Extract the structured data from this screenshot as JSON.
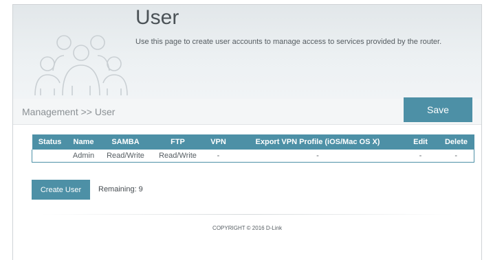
{
  "header": {
    "title": "User",
    "description": "Use this page to create user accounts to manage access to services provided by the router.",
    "icon": "user-group-icon"
  },
  "breadcrumb": "Management >> User",
  "toolbar": {
    "save_label": "Save"
  },
  "table": {
    "columns": [
      "Status",
      "Name",
      "SAMBA",
      "FTP",
      "VPN",
      "Export VPN Profile (iOS/Mac OS X)",
      "Edit",
      "Delete"
    ],
    "rows": [
      [
        "",
        "Admin",
        "Read/Write",
        "Read/Write",
        "-",
        "-",
        "-",
        "-"
      ]
    ]
  },
  "create_user": {
    "label": "Create User"
  },
  "remaining": {
    "label": "Remaining:",
    "value": "9"
  },
  "footer": {
    "copyright": "COPYRIGHT © 2016 D-Link"
  },
  "colors": {
    "accent": "#4d90a6",
    "header_bg": "#e2e7ea"
  }
}
